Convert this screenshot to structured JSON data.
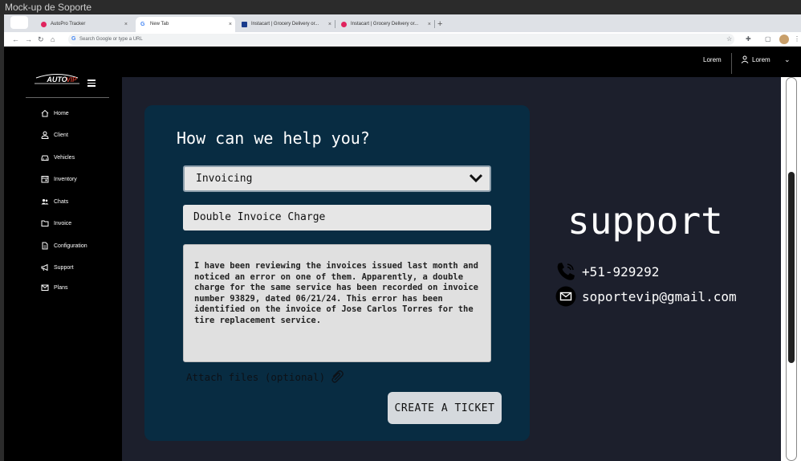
{
  "window": {
    "title": "Mock-up de Soporte"
  },
  "browser": {
    "tabs": [
      {
        "label": "AutoPro Tracker",
        "close": "×"
      },
      {
        "label": "New Tab",
        "close": "×"
      },
      {
        "label": "Instacart | Grocery Delivery or...",
        "close": "×"
      },
      {
        "label": "Instacart | Grocery Delivery or...",
        "close": "×"
      }
    ],
    "new_tab": "+",
    "omnibox_placeholder": "Search Google or type a URL"
  },
  "header": {
    "link": "Lorem",
    "user_name": "Lorem"
  },
  "sidebar": {
    "items": [
      {
        "label": "Home",
        "icon": "home-icon"
      },
      {
        "label": "Client",
        "icon": "user-icon"
      },
      {
        "label": "Vehicles",
        "icon": "car-icon"
      },
      {
        "label": "Inventory",
        "icon": "inventory-icon"
      },
      {
        "label": "Chats",
        "icon": "chat-icon"
      },
      {
        "label": "Invoice",
        "icon": "folder-icon"
      },
      {
        "label": "Configuration",
        "icon": "document-icon"
      },
      {
        "label": "Support",
        "icon": "megaphone-icon"
      },
      {
        "label": "Plans",
        "icon": "mail-icon"
      }
    ]
  },
  "form": {
    "title": "How can we help you?",
    "category": "Invoicing",
    "subject": "Double Invoice Charge",
    "message": "I have been reviewing the invoices issued last month and noticed an error on one of them. Apparently, a double charge for the same service has been recorded on invoice number 93829, dated 06/21/24. This error has been identified on the invoice of Jose Carlos Torres for the tire replacement service.",
    "attach_label": "Attach files (optional)",
    "submit_label": "CREATE A TICKET"
  },
  "support": {
    "title": "support",
    "phone": "+51-929292",
    "email": "soportevip@gmail.com"
  },
  "colors": {
    "card": "#082c42",
    "main_bg": "#1c1f2c",
    "sidebar_bg": "#000000"
  }
}
